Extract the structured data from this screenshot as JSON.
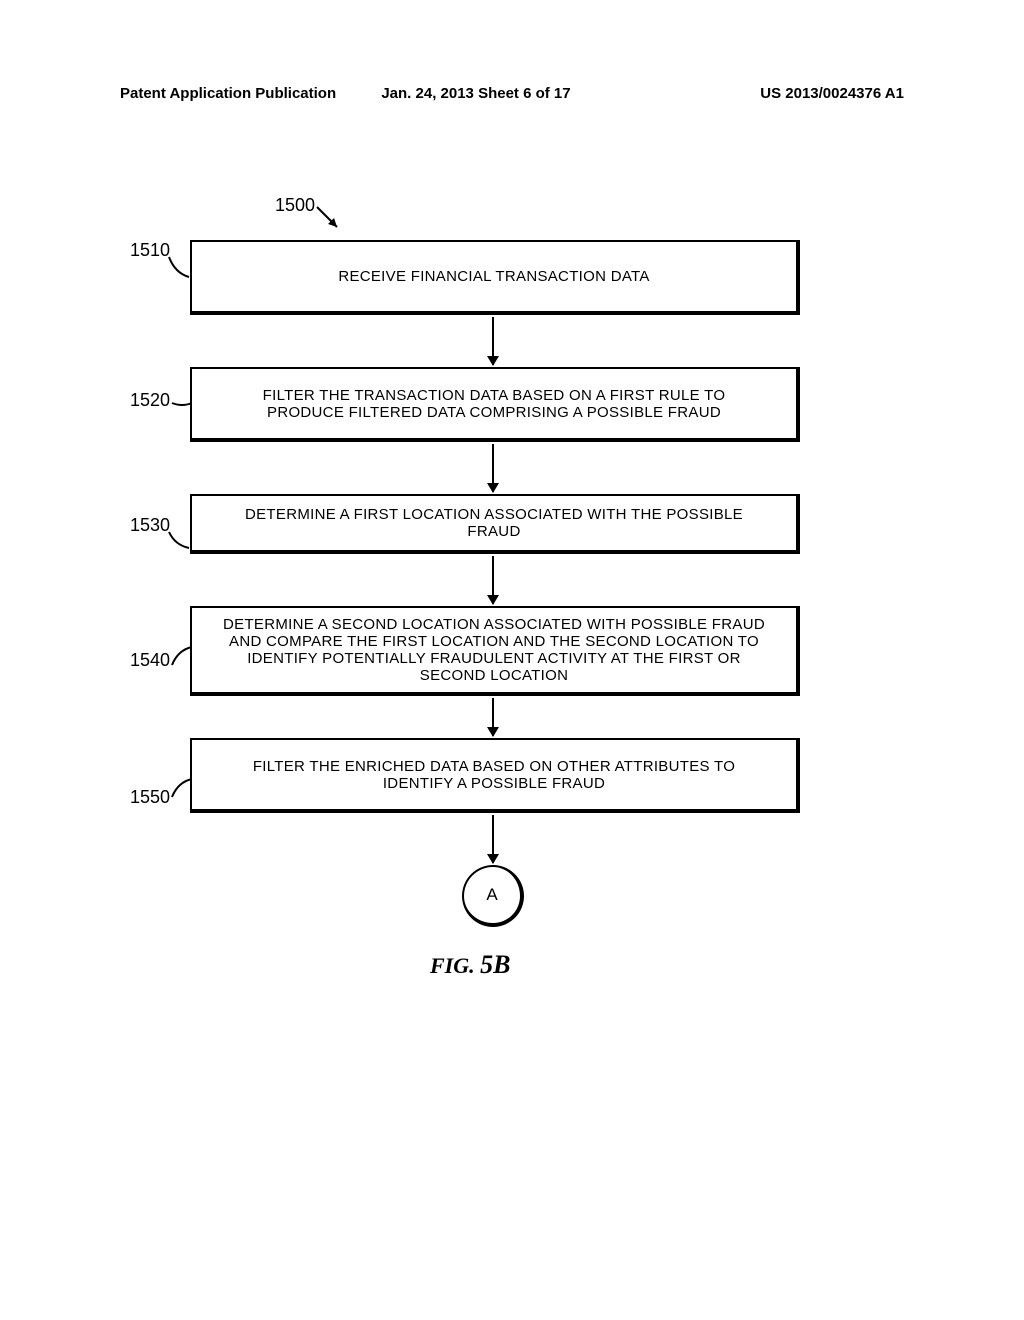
{
  "header": {
    "left": "Patent Application Publication",
    "center": "Jan. 24, 2013  Sheet 6 of 17",
    "right": "US 2013/0024376 A1"
  },
  "diagram": {
    "ref_main": "1500",
    "boxes": [
      {
        "ref": "1510",
        "text": "RECEIVE FINANCIAL TRANSACTION DATA"
      },
      {
        "ref": "1520",
        "text": "FILTER THE TRANSACTION DATA BASED ON A FIRST RULE TO PRODUCE FILTERED DATA COMPRISING A POSSIBLE FRAUD"
      },
      {
        "ref": "1530",
        "text": "DETERMINE A FIRST LOCATION ASSOCIATED WITH THE POSSIBLE FRAUD"
      },
      {
        "ref": "1540",
        "text": "DETERMINE A SECOND LOCATION ASSOCIATED WITH POSSIBLE FRAUD AND COMPARE THE FIRST LOCATION AND THE SECOND LOCATION TO IDENTIFY POTENTIALLY FRAUDULENT ACTIVITY AT THE FIRST OR SECOND LOCATION"
      },
      {
        "ref": "1550",
        "text": "FILTER THE ENRICHED DATA BASED ON OTHER ATTRIBUTES TO IDENTIFY A POSSIBLE FRAUD"
      }
    ],
    "connector": "A",
    "figure_label": "FIG.",
    "figure_number": "5B"
  },
  "chart_data": {
    "type": "table",
    "title": "Flowchart 1500 - Financial Fraud Detection Process",
    "nodes": [
      {
        "id": "1510",
        "type": "process",
        "text": "RECEIVE FINANCIAL TRANSACTION DATA"
      },
      {
        "id": "1520",
        "type": "process",
        "text": "FILTER THE TRANSACTION DATA BASED ON A FIRST RULE TO PRODUCE FILTERED DATA COMPRISING A POSSIBLE FRAUD"
      },
      {
        "id": "1530",
        "type": "process",
        "text": "DETERMINE A FIRST LOCATION ASSOCIATED WITH THE POSSIBLE FRAUD"
      },
      {
        "id": "1540",
        "type": "process",
        "text": "DETERMINE A SECOND LOCATION ASSOCIATED WITH POSSIBLE FRAUD AND COMPARE THE FIRST LOCATION AND THE SECOND LOCATION TO IDENTIFY POTENTIALLY FRAUDULENT ACTIVITY AT THE FIRST OR SECOND LOCATION"
      },
      {
        "id": "1550",
        "type": "process",
        "text": "FILTER THE ENRICHED DATA BASED ON OTHER ATTRIBUTES TO IDENTIFY A POSSIBLE FRAUD"
      },
      {
        "id": "A",
        "type": "connector",
        "text": "A"
      }
    ],
    "edges": [
      {
        "from": "1510",
        "to": "1520"
      },
      {
        "from": "1520",
        "to": "1530"
      },
      {
        "from": "1530",
        "to": "1540"
      },
      {
        "from": "1540",
        "to": "1550"
      },
      {
        "from": "1550",
        "to": "A"
      }
    ],
    "figure": "FIG. 5B"
  }
}
